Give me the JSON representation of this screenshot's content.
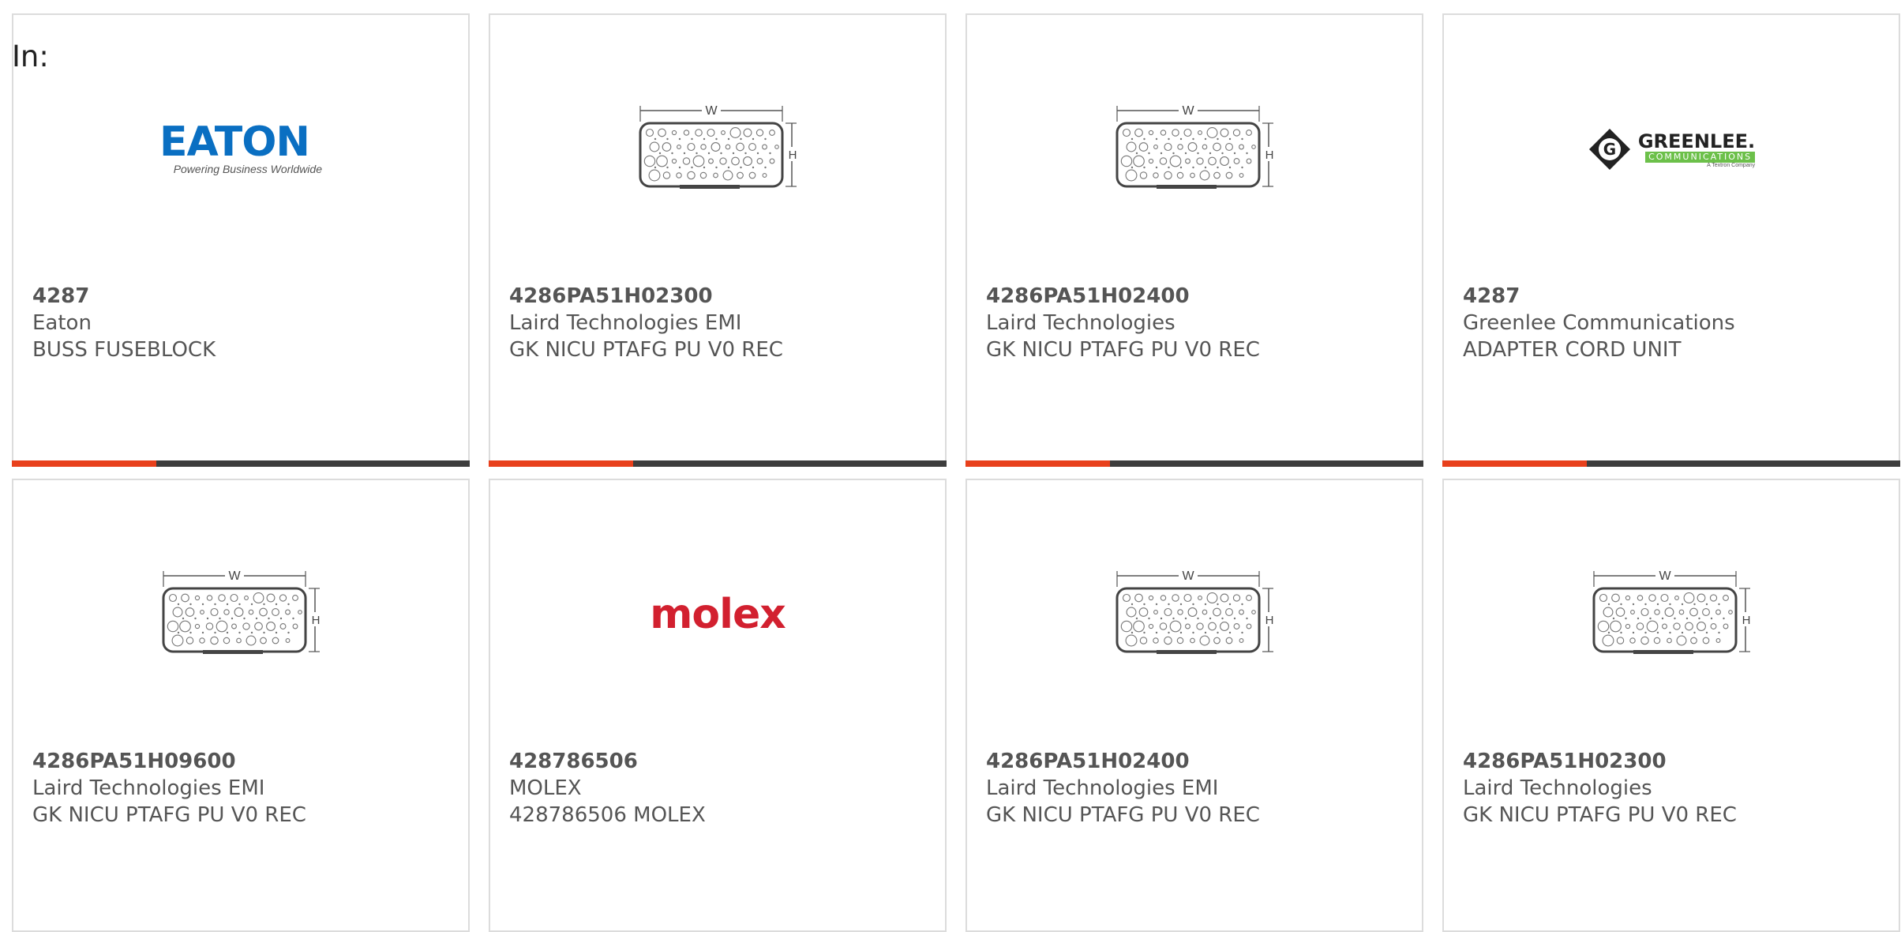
{
  "filter": {
    "label": "In:"
  },
  "products": [
    {
      "part_number": "4287",
      "manufacturer": "Eaton",
      "description": "BUSS FUSEBLOCK",
      "image": "eaton-logo",
      "logo_text": "EATON",
      "logo_tagline": "Powering Business Worldwide",
      "has_bar": true
    },
    {
      "part_number": "4286PA51H02300",
      "manufacturer": "Laird Technologies EMI",
      "description": "GK NICU PTAFG PU V0 REC",
      "image": "gasket-diagram",
      "has_bar": true
    },
    {
      "part_number": "4286PA51H02400",
      "manufacturer": "Laird Technologies",
      "description": "GK NICU PTAFG PU V0 REC",
      "image": "gasket-diagram",
      "has_bar": true
    },
    {
      "part_number": "4287",
      "manufacturer": "Greenlee Communications",
      "description": "ADAPTER CORD UNIT",
      "image": "greenlee-logo",
      "logo_text": "GREENLEE.",
      "logo_sub": "COMMUNICATIONS",
      "logo_tagline": "A Textron Company",
      "has_bar": true
    },
    {
      "part_number": "4286PA51H09600",
      "manufacturer": "Laird Technologies EMI",
      "description": "GK NICU PTAFG PU V0 REC",
      "image": "gasket-diagram",
      "has_bar": false
    },
    {
      "part_number": "428786506",
      "manufacturer": "MOLEX",
      "description": "428786506 MOLEX",
      "image": "molex-logo",
      "logo_text": "molex",
      "has_bar": false
    },
    {
      "part_number": "4286PA51H02400",
      "manufacturer": "Laird Technologies EMI",
      "description": "GK NICU PTAFG PU V0 REC",
      "image": "gasket-diagram",
      "has_bar": false
    },
    {
      "part_number": "4286PA51H02300",
      "manufacturer": "Laird Technologies",
      "description": "GK NICU PTAFG PU V0 REC",
      "image": "gasket-diagram",
      "has_bar": false
    }
  ],
  "diagram": {
    "width_label": "W",
    "height_label": "H"
  },
  "colors": {
    "accent": "#e8401c",
    "bar": "#3d3d3d",
    "text": "#555555",
    "eaton_blue": "#0a6fc2",
    "molex_red": "#d2202f",
    "greenlee_green": "#6cc04a"
  }
}
